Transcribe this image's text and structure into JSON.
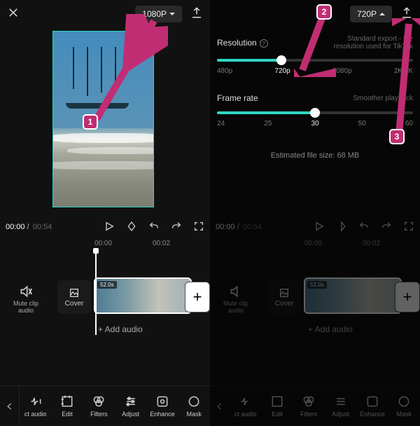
{
  "left": {
    "resolution_button": "1080P",
    "time_current": "00:00",
    "time_duration": "00:54",
    "ruler": [
      "00:00",
      "00:02"
    ],
    "mute_label_line1": "Mute clip",
    "mute_label_line2": "audio",
    "cover_label": "Cover",
    "clip_badge": "52.0s",
    "add_clip": "+",
    "add_audio": "+  Add audio",
    "toolbar": [
      {
        "id": "extract-audio",
        "label": "ct audio"
      },
      {
        "id": "edit",
        "label": "Edit"
      },
      {
        "id": "filters",
        "label": "Filters"
      },
      {
        "id": "adjust",
        "label": "Adjust"
      },
      {
        "id": "enhance",
        "label": "Enhance"
      },
      {
        "id": "mask",
        "label": "Mask"
      }
    ]
  },
  "right": {
    "resolution_button": "720P",
    "resolution": {
      "label": "Resolution",
      "hint": "Standard export - the resolution used for TikTok",
      "ticks": [
        "480p",
        "720p",
        "1080p",
        "2K/4K"
      ],
      "selected_index": 1,
      "fill_pct": 33
    },
    "framerate": {
      "label": "Frame rate",
      "hint": "Smoother playback",
      "ticks": [
        "24",
        "25",
        "30",
        "50",
        "60"
      ],
      "selected_index": 2,
      "fill_pct": 50
    },
    "estimate": "Estimated file size: 68 MB",
    "time_current": "00:00",
    "time_duration": "00:54",
    "ruler": [
      "00:00",
      "00:02"
    ],
    "mute_label_line1": "Mute clip",
    "mute_label_line2": "audio",
    "cover_label": "Cover",
    "clip_badge": "52.0s",
    "add_clip": "+",
    "add_audio": "+  Add audio",
    "toolbar": [
      {
        "id": "extract-audio",
        "label": "ct audio"
      },
      {
        "id": "edit",
        "label": "Edit"
      },
      {
        "id": "filters",
        "label": "Filters"
      },
      {
        "id": "adjust",
        "label": "Adjust"
      },
      {
        "id": "enhance",
        "label": "Enhance"
      },
      {
        "id": "mask",
        "label": "Mask"
      }
    ]
  },
  "annotations": {
    "b1": "1",
    "b2": "2",
    "b3": "3"
  }
}
